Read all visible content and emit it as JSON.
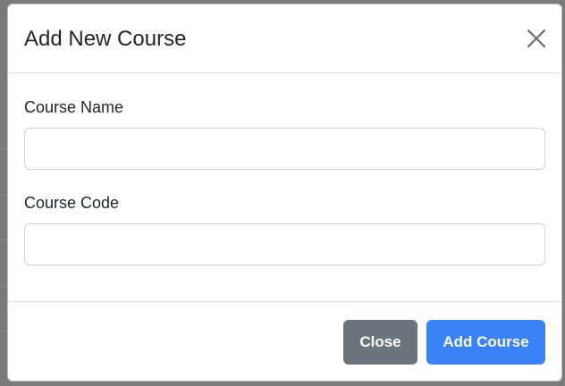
{
  "modal": {
    "title": "Add New Course",
    "close_icon": "close-icon"
  },
  "form": {
    "course_name_label": "Course Name",
    "course_name_value": "",
    "course_code_label": "Course Code",
    "course_code_value": ""
  },
  "footer": {
    "close_label": "Close",
    "add_label": "Add Course"
  },
  "colors": {
    "close_button": "#6c757d",
    "add_button": "#3b82f6"
  }
}
